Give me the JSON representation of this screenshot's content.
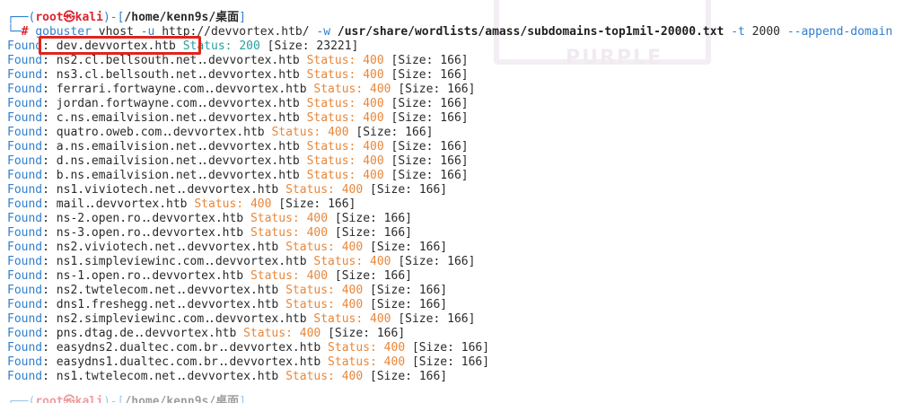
{
  "watermark": {
    "text": "PURPLE"
  },
  "prompt": {
    "corner_top": "┌──(",
    "user": "root㉿kali",
    "sep": ")-[",
    "path": "/home/kenn9s/桌面",
    "close": "]",
    "corner_bottom": "└─",
    "hash": "# "
  },
  "command": {
    "tool": "gobuster",
    "mode": " vhost ",
    "url_flag": "-u",
    "url": " http://devvortex.htb/ ",
    "wordlist_flag": "-w",
    "wordlist": " /usr/share/wordlists/amass/subdomains-top1mil-20000.txt ",
    "threads_flag": "-t",
    "threads": " 2000 ",
    "append_flag": "--append-domain"
  },
  "results": [
    {
      "label": "Found",
      "host": ": dev.devvortex.htb",
      "status_label": "Status:",
      "status": "200",
      "size": "[Size: 23221]"
    },
    {
      "label": "Found",
      "host": ": ns2.cl.bellsouth.net",
      "suffix": "devvortex.htb",
      "status_label": "Status:",
      "status": "400",
      "size": "[Size: 166]"
    },
    {
      "label": "Found",
      "host": ": ns3.cl.bellsouth.net",
      "suffix": "devvortex.htb",
      "status_label": "Status:",
      "status": "400",
      "size": "[Size: 166]"
    },
    {
      "label": "Found",
      "host": ": ferrari.fortwayne.com",
      "suffix": "devvortex.htb",
      "status_label": "Status:",
      "status": "400",
      "size": "[Size: 166]"
    },
    {
      "label": "Found",
      "host": ": jordan.fortwayne.com",
      "suffix": "devvortex.htb",
      "status_label": "Status:",
      "status": "400",
      "size": "[Size: 166]"
    },
    {
      "label": "Found",
      "host": ": c.ns.emailvision.net",
      "suffix": "devvortex.htb",
      "status_label": "Status:",
      "status": "400",
      "size": "[Size: 166]"
    },
    {
      "label": "Found",
      "host": ": quatro.oweb.com",
      "suffix": "devvortex.htb",
      "status_label": "Status:",
      "status": "400",
      "size": "[Size: 166]"
    },
    {
      "label": "Found",
      "host": ": a.ns.emailvision.net",
      "suffix": "devvortex.htb",
      "status_label": "Status:",
      "status": "400",
      "size": "[Size: 166]"
    },
    {
      "label": "Found",
      "host": ": d.ns.emailvision.net",
      "suffix": "devvortex.htb",
      "status_label": "Status:",
      "status": "400",
      "size": "[Size: 166]"
    },
    {
      "label": "Found",
      "host": ": b.ns.emailvision.net",
      "suffix": "devvortex.htb",
      "status_label": "Status:",
      "status": "400",
      "size": "[Size: 166]"
    },
    {
      "label": "Found",
      "host": ": ns1.viviotech.net",
      "suffix": "devvortex.htb",
      "status_label": "Status:",
      "status": "400",
      "size": "[Size: 166]"
    },
    {
      "label": "Found",
      "host": ": mail",
      "suffix": "devvortex.htb",
      "status_label": "Status:",
      "status": "400",
      "size": "[Size: 166]"
    },
    {
      "label": "Found",
      "host": ": ns-2.open.ro",
      "suffix": "devvortex.htb",
      "status_label": "Status:",
      "status": "400",
      "size": "[Size: 166]"
    },
    {
      "label": "Found",
      "host": ": ns-3.open.ro",
      "suffix": "devvortex.htb",
      "status_label": "Status:",
      "status": "400",
      "size": "[Size: 166]"
    },
    {
      "label": "Found",
      "host": ": ns2.viviotech.net",
      "suffix": "devvortex.htb",
      "status_label": "Status:",
      "status": "400",
      "size": "[Size: 166]"
    },
    {
      "label": "Found",
      "host": ": ns1.simpleviewinc.com",
      "suffix": "devvortex.htb",
      "status_label": "Status:",
      "status": "400",
      "size": "[Size: 166]"
    },
    {
      "label": "Found",
      "host": ": ns-1.open.ro",
      "suffix": "devvortex.htb",
      "status_label": "Status:",
      "status": "400",
      "size": "[Size: 166]"
    },
    {
      "label": "Found",
      "host": ": ns2.twtelecom.net",
      "suffix": "devvortex.htb",
      "status_label": "Status:",
      "status": "400",
      "size": "[Size: 166]"
    },
    {
      "label": "Found",
      "host": ": dns1.freshegg.net",
      "suffix": "devvortex.htb",
      "status_label": "Status:",
      "status": "400",
      "size": "[Size: 166]"
    },
    {
      "label": "Found",
      "host": ": ns2.simpleviewinc.com",
      "suffix": "devvortex.htb",
      "status_label": "Status:",
      "status": "400",
      "size": "[Size: 166]"
    },
    {
      "label": "Found",
      "host": ": pns.dtag.de",
      "suffix": "devvortex.htb",
      "status_label": "Status:",
      "status": "400",
      "size": "[Size: 166]"
    },
    {
      "label": "Found",
      "host": ": easydns2.dualtec.com.br",
      "suffix": "devvortex.htb",
      "status_label": "Status:",
      "status": "400",
      "size": "[Size: 166]"
    },
    {
      "label": "Found",
      "host": ": easydns1.dualtec.com.br",
      "suffix": "devvortex.htb",
      "status_label": "Status:",
      "status": "400",
      "size": "[Size: 166]"
    },
    {
      "label": "Found",
      "host": ": ns1.twtelecom.net",
      "suffix": "devvortex.htb",
      "status_label": "Status:",
      "status": "400",
      "size": "[Size: 166]"
    }
  ],
  "colors": {
    "prompt_blue": "#2f7fd0",
    "prompt_red": "#d8252f",
    "status_orange": "#e8873a",
    "status_ok_teal": "#27a0a0",
    "highlight_red": "#e0241c"
  }
}
